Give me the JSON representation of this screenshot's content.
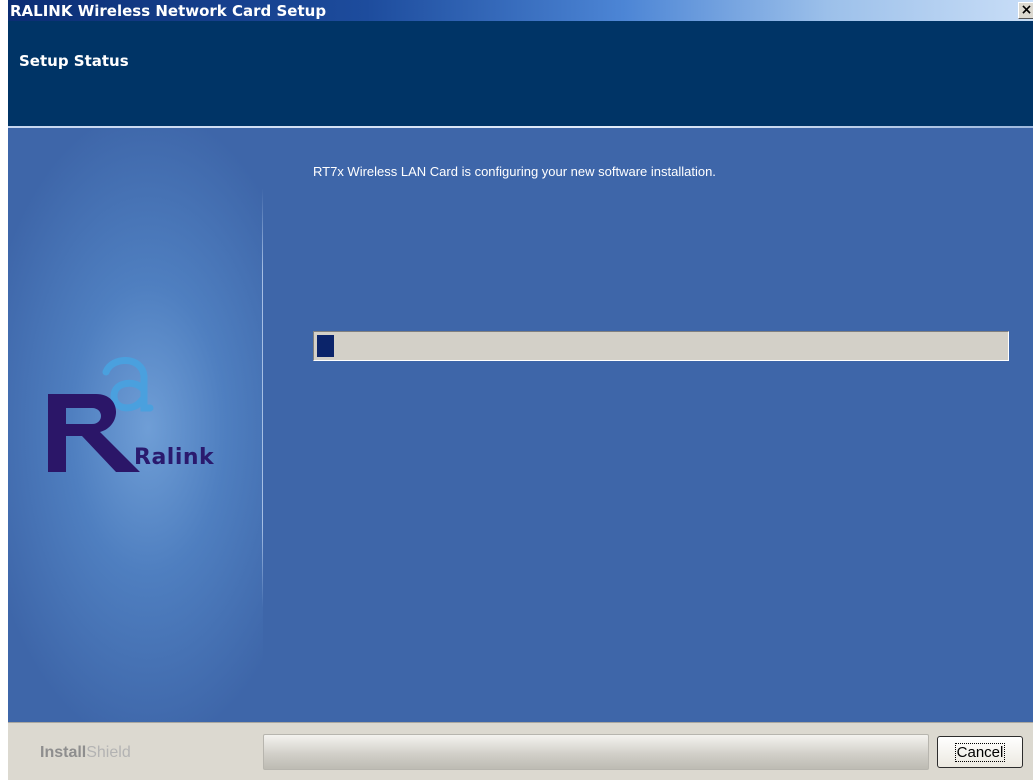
{
  "window": {
    "title": "RALINK Wireless Network Card Setup",
    "close_symbol": "×"
  },
  "header": {
    "title": "Setup Status"
  },
  "main": {
    "message": "RT7x Wireless LAN Card is configuring your new software installation.",
    "progress_fraction": 0.024
  },
  "logo": {
    "text": "Ralink",
    "colors": {
      "letter_r": "#2b1668",
      "letter_a": "#4aa0de"
    }
  },
  "footer": {
    "brand_part1": "Install",
    "brand_part2": "Shield",
    "cancel_label": "Cancel"
  },
  "icons": [
    "close-icon",
    "ralink-logo"
  ],
  "colors": {
    "title_bar": "#0b2d74",
    "header_bg": "#003466",
    "content_bg": "#3e66a9",
    "progress_track": "#d3d0c8",
    "progress_fill": "#0b246a",
    "footer_bg": "#dcd9d0"
  }
}
